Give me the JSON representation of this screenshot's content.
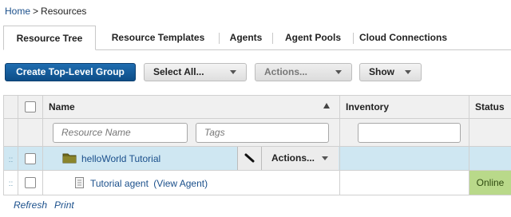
{
  "breadcrumb": {
    "home": "Home",
    "separator": ">",
    "current": "Resources"
  },
  "tabs": [
    {
      "label": "Resource Tree",
      "active": true
    },
    {
      "label": "Resource Templates",
      "active": false
    },
    {
      "label": "Agents",
      "active": false
    },
    {
      "label": "Agent Pools",
      "active": false
    },
    {
      "label": "Cloud Connections",
      "active": false
    }
  ],
  "toolbar": {
    "create_label": "Create Top-Level Group",
    "select_all_label": "Select All...",
    "actions_label": "Actions...",
    "show_label": "Show"
  },
  "grid": {
    "columns": {
      "name": "Name",
      "inventory": "Inventory",
      "status": "Status"
    },
    "filters": {
      "resource_name_placeholder": "Resource Name",
      "tags_placeholder": "Tags"
    },
    "rows": [
      {
        "name": "helloWorld Tutorial",
        "actions_label": "Actions...",
        "type": "group",
        "selected": true
      },
      {
        "name": "Tutorial agent",
        "view_link": "(View Agent)",
        "status": "Online",
        "type": "agent"
      }
    ]
  },
  "footer": {
    "refresh": "Refresh",
    "print": "Print"
  },
  "colors": {
    "primary": "#0d4d87",
    "link": "#1a4f8b",
    "selected_row": "#cfe7f2",
    "online": "#b9d98a"
  }
}
